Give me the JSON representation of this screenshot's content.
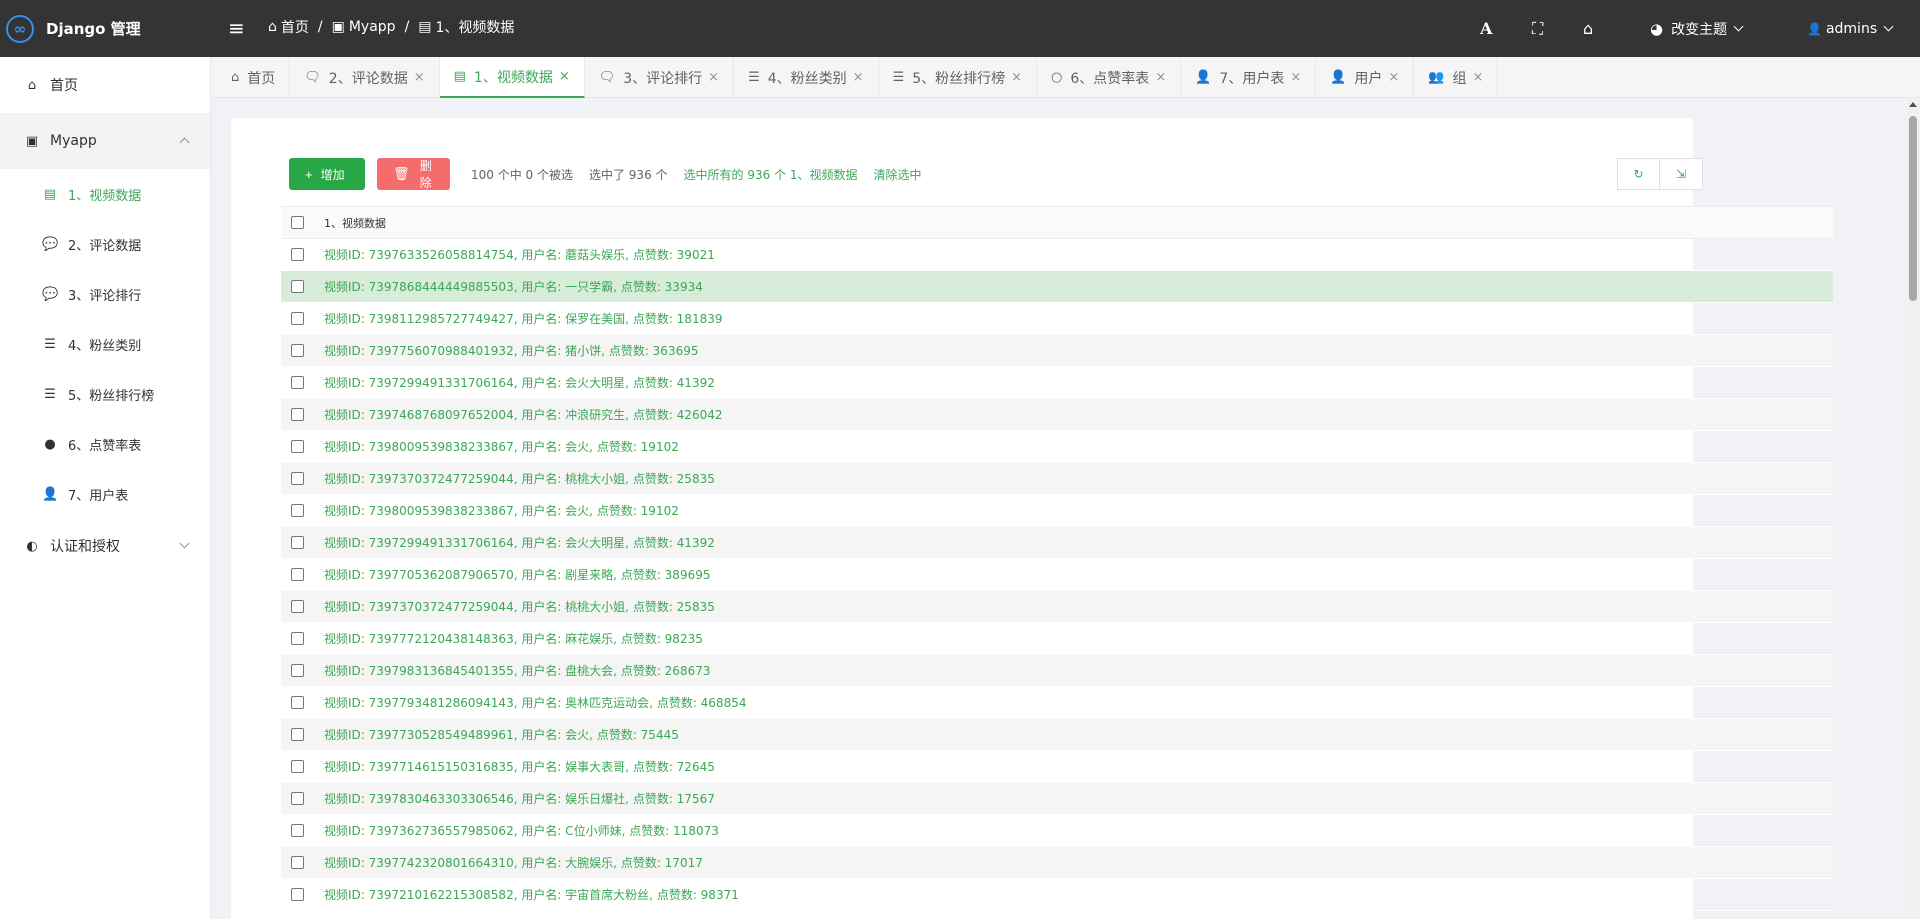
{
  "app": {
    "title": "Django 管理",
    "logo_glyph": "∞"
  },
  "breadcrumb": [
    {
      "label": "首页",
      "icon": "⌂"
    },
    {
      "label": "Myapp",
      "icon": "▣"
    },
    {
      "label": "1、视频数据",
      "icon": "▤"
    }
  ],
  "breadcrumb_sep": "/",
  "topbar": {
    "font_icon": "A",
    "fullscreen_icon": "⛶",
    "home_icon": "⌂",
    "theme_label": "改变主题",
    "theme_icon": "◕",
    "user_label": "admins",
    "user_icon": "👤"
  },
  "sidebar": {
    "home": {
      "label": "首页",
      "icon": "⌂"
    },
    "group_myapp": {
      "label": "Myapp",
      "icon": "▣"
    },
    "sub_items": [
      {
        "label": "1、视频数据",
        "icon": "▤",
        "active": true
      },
      {
        "label": "2、评论数据",
        "icon": "💬"
      },
      {
        "label": "3、评论排行",
        "icon": "💬"
      },
      {
        "label": "4、粉丝类别",
        "icon": "☰"
      },
      {
        "label": "5、粉丝排行榜",
        "icon": "☰"
      },
      {
        "label": "6、点赞率表",
        "icon": "●"
      },
      {
        "label": "7、用户表",
        "icon": "👤"
      }
    ],
    "group_auth": {
      "label": "认证和授权",
      "icon": "◐"
    }
  },
  "tabs": [
    {
      "label": "首页",
      "icon": "⌂",
      "closable": false
    },
    {
      "label": "2、评论数据",
      "icon": "🗨",
      "closable": true
    },
    {
      "label": "1、视频数据",
      "icon": "▤",
      "closable": true,
      "active": true
    },
    {
      "label": "3、评论排行",
      "icon": "🗨",
      "closable": true
    },
    {
      "label": "4、粉丝类别",
      "icon": "☰",
      "closable": true
    },
    {
      "label": "5、粉丝排行榜",
      "icon": "☰",
      "closable": true
    },
    {
      "label": "6、点赞率表",
      "icon": "○",
      "closable": true
    },
    {
      "label": "7、用户表",
      "icon": "👤",
      "closable": true
    },
    {
      "label": "用户",
      "icon": "👤",
      "closable": true
    },
    {
      "label": "组",
      "icon": "👥",
      "closable": true
    }
  ],
  "tab_close_glyph": "×",
  "toolbar": {
    "add_label": "增加",
    "add_icon": "+",
    "delete_label": "删除",
    "delete_icon": "🗑",
    "selection_count": "100 个中 0 个被选",
    "selected_total": "选中了 936 个",
    "select_all_link": "选中所有的 936 个 1、视频数据",
    "clear_selection_link": "清除选中",
    "refresh_icon": "↻",
    "export_icon": "⇲"
  },
  "table": {
    "header": "1、视频数据",
    "selected_row_index": 1,
    "rows": [
      "视频ID: 7397633526058814754, 用户名: 蘑菇头娱乐, 点赞数: 39021",
      "视频ID: 7397868444449885503, 用户名: 一只学霸, 点赞数: 33934",
      "视频ID: 7398112985727749427, 用户名: 保罗在美国, 点赞数: 181839",
      "视频ID: 7397756070988401932, 用户名: 猪小饼, 点赞数: 363695",
      "视频ID: 7397299491331706164, 用户名: 会火大明星, 点赞数: 41392",
      "视频ID: 7397468768097652004, 用户名: 冲浪研究生, 点赞数: 426042",
      "视频ID: 7398009539838233867, 用户名: 会火, 点赞数: 19102",
      "视频ID: 7397370372477259044, 用户名: 桃桃大小姐, 点赞数: 25835",
      "视频ID: 7398009539838233867, 用户名: 会火, 点赞数: 19102",
      "视频ID: 7397299491331706164, 用户名: 会火大明星, 点赞数: 41392",
      "视频ID: 7397705362087906570, 用户名: 剧星来略, 点赞数: 389695",
      "视频ID: 7397370372477259044, 用户名: 桃桃大小姐, 点赞数: 25835",
      "视频ID: 7397772120438148363, 用户名: 麻花娱乐, 点赞数: 98235",
      "视频ID: 7397983136845401355, 用户名: 盘桃大会, 点赞数: 268673",
      "视频ID: 7397793481286094143, 用户名: 奥林匹克运动会, 点赞数: 468854",
      "视频ID: 7397730528549489961, 用户名: 会火, 点赞数: 75445",
      "视频ID: 7397714615150316835, 用户名: 娱事大表哥, 点赞数: 72645",
      "视频ID: 7397830463303306546, 用户名: 娱乐日爆社, 点赞数: 17567",
      "视频ID: 7397362736557985062, 用户名: C位小师妹, 点赞数: 118073",
      "视频ID: 7397742320801664310, 用户名: 大腕娱乐, 点赞数: 17017",
      "视频ID: 7397210162215308582, 用户名: 宇宙首席大粉丝, 点赞数: 98371"
    ]
  },
  "colors": {
    "accent": "#3ba755",
    "topbar": "#343434",
    "add_button": "#28a745",
    "delete_button": "#f56c6c",
    "selected_row": "#d7ecd9"
  }
}
